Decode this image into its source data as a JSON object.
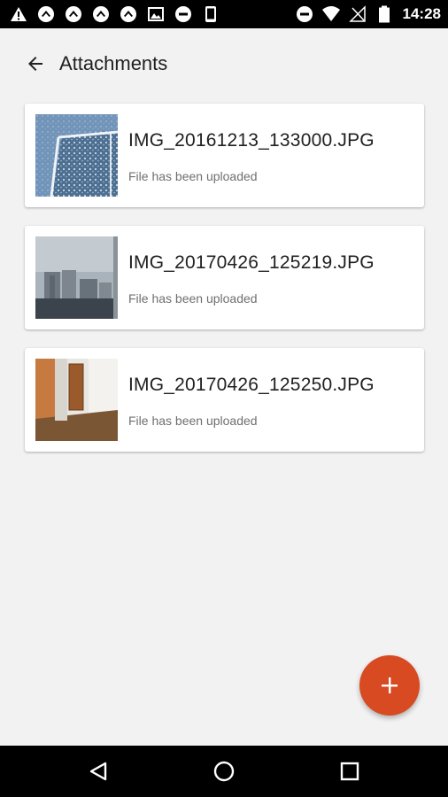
{
  "status_bar": {
    "time": "14:28",
    "left_icons": [
      "warning-icon",
      "nav-arrow-icon",
      "nav-arrow-icon",
      "nav-arrow-icon",
      "nav-arrow-icon",
      "image-icon",
      "do-not-disturb-icon",
      "phone-icon"
    ],
    "right_icons": [
      "do-not-disturb-icon",
      "wifi-icon",
      "no-signal-icon",
      "battery-icon"
    ]
  },
  "header": {
    "title": "Attachments",
    "back_icon": "arrow-back-icon"
  },
  "attachments": [
    {
      "filename": "IMG_20161213_133000.JPG",
      "status": "File has been uploaded",
      "thumbnail": "snow-photo"
    },
    {
      "filename": "IMG_20170426_125219.JPG",
      "status": "File has been uploaded",
      "thumbnail": "buildings-photo"
    },
    {
      "filename": "IMG_20170426_125250.JPG",
      "status": "File has been uploaded",
      "thumbnail": "hallway-photo"
    }
  ],
  "fab": {
    "icon": "plus-icon",
    "color": "#d84a22"
  },
  "nav_bar": {
    "buttons": [
      "back-triangle-icon",
      "home-circle-icon",
      "recents-square-icon"
    ]
  }
}
